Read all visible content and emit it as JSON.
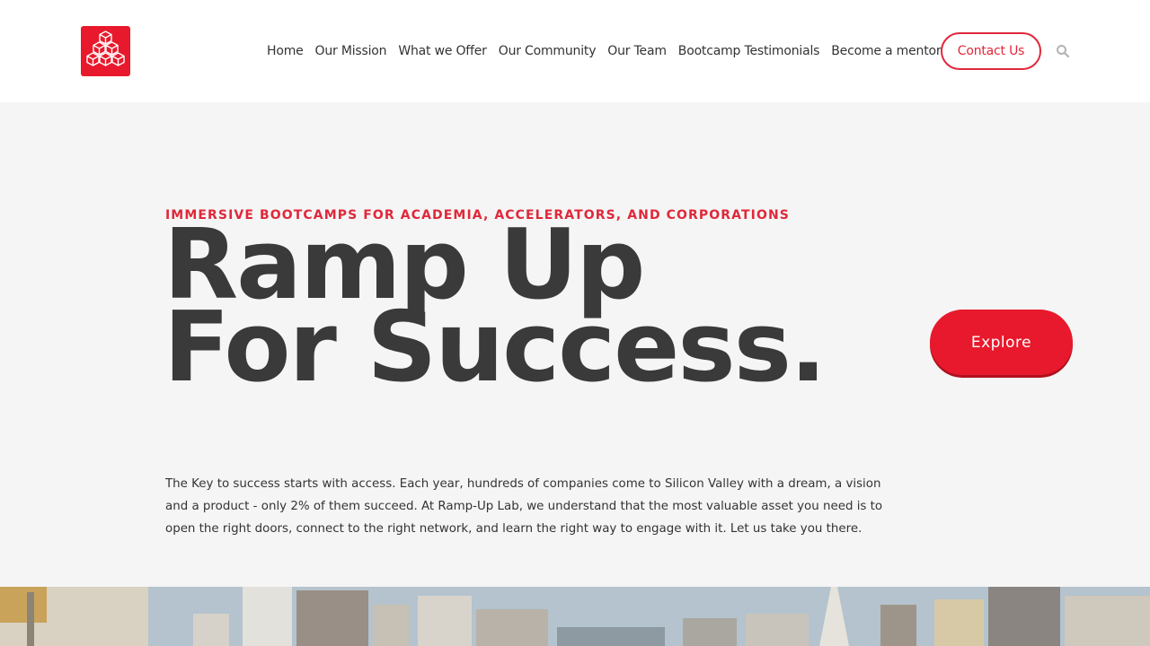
{
  "nav": {
    "items": [
      {
        "label": "Home"
      },
      {
        "label": "Our Mission"
      },
      {
        "label": "What we Offer"
      },
      {
        "label": "Our Community"
      },
      {
        "label": "Our Team"
      },
      {
        "label": "Bootcamp Testimonials"
      },
      {
        "label": "Become a mentor"
      }
    ],
    "contact_label": "Contact Us",
    "search_icon": "search-icon"
  },
  "hero": {
    "eyebrow": "IMMERSIVE BOOTCAMPS FOR ACADEMIA, ACCELERATORS, AND CORPORATIONS",
    "title_line1": "Ramp Up",
    "title_line2": "For Success.",
    "explore_label": "Explore",
    "description": "The Key to success starts with access. Each year, hundreds of companies come to Silicon Valley with a dream, a vision and a product - only 2% of them succeed. At Ramp-Up Lab, we understand that the most valuable asset you need is to open the right doors, connect to the right network, and learn the right way to engage with it. Let us take you there."
  },
  "colors": {
    "accent": "#e8192c",
    "title": "#3a3a3a",
    "background": "#f5f5f5"
  }
}
